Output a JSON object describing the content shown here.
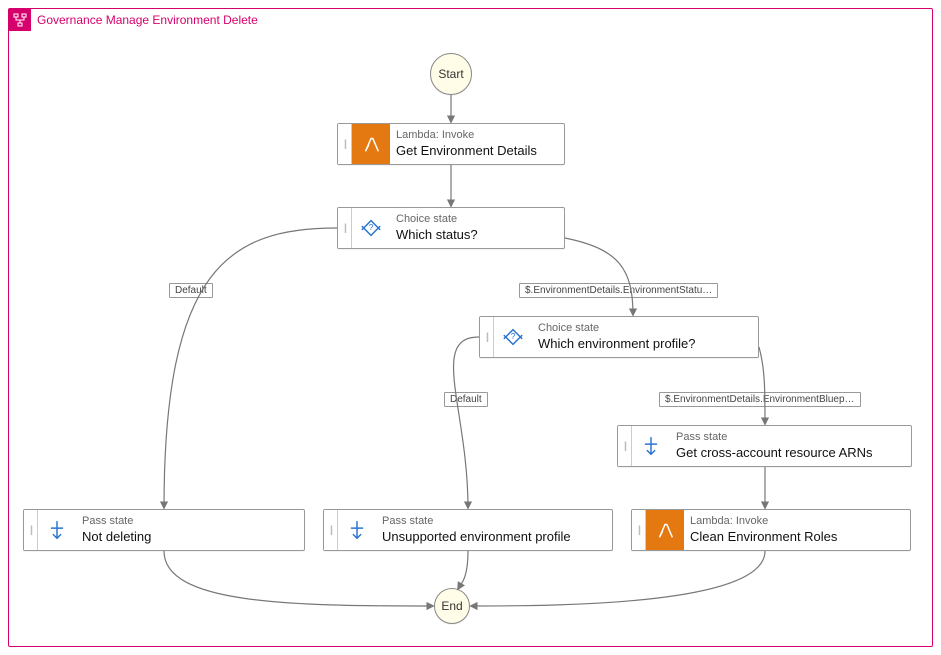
{
  "chart_data": {
    "type": "diagram",
    "title": "Governance Manage Environment Delete",
    "start": "Start",
    "end": "End",
    "nodes": [
      {
        "id": "get_env_details",
        "kind": "Lambda: Invoke",
        "label": "Get Environment Details"
      },
      {
        "id": "which_status",
        "kind": "Choice state",
        "label": "Which status?"
      },
      {
        "id": "which_profile",
        "kind": "Choice state",
        "label": "Which environment profile?"
      },
      {
        "id": "get_arns",
        "kind": "Pass state",
        "label": "Get cross-account resource ARNs"
      },
      {
        "id": "not_deleting",
        "kind": "Pass state",
        "label": "Not deleting"
      },
      {
        "id": "unsupported_profile",
        "kind": "Pass state",
        "label": "Unsupported environment profile"
      },
      {
        "id": "clean_roles",
        "kind": "Lambda: Invoke",
        "label": "Clean Environment Roles"
      }
    ],
    "edges": [
      {
        "from": "start",
        "to": "get_env_details"
      },
      {
        "from": "get_env_details",
        "to": "which_status"
      },
      {
        "from": "which_status",
        "to": "not_deleting",
        "label": "Default"
      },
      {
        "from": "which_status",
        "to": "which_profile",
        "label": "$.EnvironmentDetails.EnvironmentStatu…"
      },
      {
        "from": "which_profile",
        "to": "unsupported_profile",
        "label": "Default"
      },
      {
        "from": "which_profile",
        "to": "get_arns",
        "label": "$.EnvironmentDetails.EnvironmentBluep…"
      },
      {
        "from": "get_arns",
        "to": "clean_roles"
      },
      {
        "from": "not_deleting",
        "to": "end"
      },
      {
        "from": "unsupported_profile",
        "to": "end"
      },
      {
        "from": "clean_roles",
        "to": "end"
      }
    ]
  },
  "header": {
    "title": "Governance Manage Environment Delete"
  },
  "start_label": "Start",
  "end_label": "End",
  "steps": {
    "get_env_details": {
      "type": "Lambda: Invoke",
      "title": "Get Environment Details"
    },
    "which_status": {
      "type": "Choice state",
      "title": "Which status?"
    },
    "which_profile": {
      "type": "Choice state",
      "title": "Which environment profile?"
    },
    "get_arns": {
      "type": "Pass state",
      "title": "Get cross-account resource ARNs"
    },
    "not_deleting": {
      "type": "Pass state",
      "title": "Not deleting"
    },
    "unsupported_profile": {
      "type": "Pass state",
      "title": "Unsupported environment profile"
    },
    "clean_roles": {
      "type": "Lambda: Invoke",
      "title": "Clean Environment Roles"
    }
  },
  "conditions": {
    "default1": "Default",
    "status_path": "$.EnvironmentDetails.EnvironmentStatu…",
    "default2": "Default",
    "blueprint_path": "$.EnvironmentDetails.EnvironmentBluep…"
  }
}
